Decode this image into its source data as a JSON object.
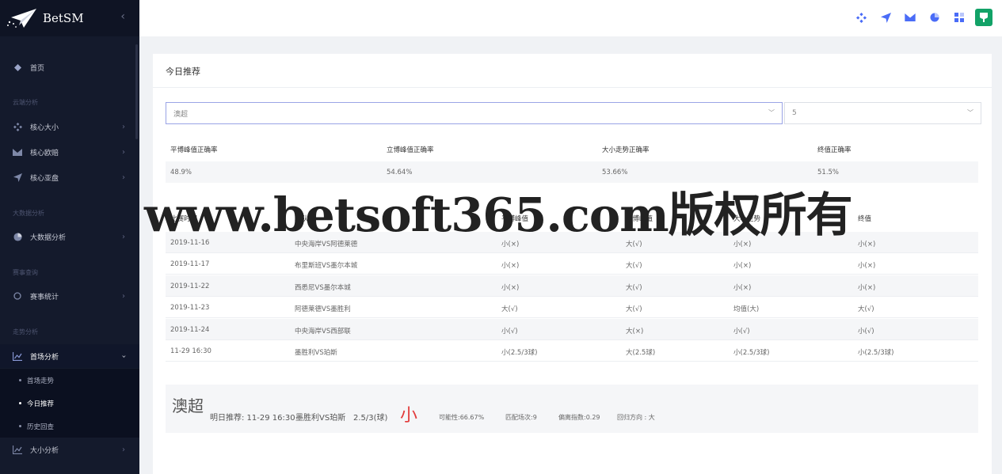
{
  "brand": {
    "name": "BetSM",
    "collapse_icon": "chevron-left-icon"
  },
  "sidebar": {
    "home": "首页",
    "groups": [
      "云端分析",
      "大数据分析",
      "赛事查询",
      "走势分析"
    ],
    "items": [
      {
        "label": "核心大小",
        "icon": "diamond-cluster-icon"
      },
      {
        "label": "核心欧赔",
        "icon": "mail-icon"
      },
      {
        "label": "核心亚盘",
        "icon": "send-icon"
      },
      {
        "label": "大数据分析",
        "icon": "pie-icon"
      },
      {
        "label": "赛事统计",
        "icon": "circle-icon"
      },
      {
        "label": "首场分析",
        "icon": "line-chart-icon"
      },
      {
        "label": "大小分析",
        "icon": "line-chart-icon"
      }
    ],
    "sub_items": [
      "首场走势",
      "今日推荐",
      "历史回查"
    ]
  },
  "card": {
    "title": "今日推荐"
  },
  "filters": {
    "league": "澳超",
    "count": "5"
  },
  "rates": {
    "headers": [
      "平博峰值正确率",
      "立博峰值正确率",
      "大小走势正确率",
      "终值正确率"
    ],
    "values": [
      "48.9%",
      "54.64%",
      "53.66%",
      "51.5%"
    ]
  },
  "table": {
    "headers": [
      "比赛时间",
      "球队",
      "平博峰值",
      "立博峰值",
      "大小走势",
      "终值"
    ],
    "rows": [
      [
        "2019-11-16",
        "中央海岸VS阿德莱德",
        "小(×)",
        "大(√)",
        "小(×)",
        "小(×)"
      ],
      [
        "2019-11-17",
        "布里斯班VS墨尔本城",
        "小(×)",
        "大(√)",
        "小(×)",
        "小(×)"
      ],
      [
        "2019-11-22",
        "西悉尼VS墨尔本城",
        "小(×)",
        "大(√)",
        "小(×)",
        "小(×)"
      ],
      [
        "2019-11-23",
        "阿德莱德VS墨胜利",
        "大(√)",
        "大(√)",
        "均值(大)",
        "大(√)"
      ],
      [
        "2019-11-24",
        "中央海岸VS西部联",
        "小(√)",
        "大(×)",
        "小(√)",
        "小(√)"
      ],
      [
        "11-29 16:30",
        "墨胜利VS珀斯",
        "小(2.5/3球)",
        "大(2.5球)",
        "小(2.5/3球)",
        "小(2.5/3球)"
      ]
    ]
  },
  "summary": {
    "league": "澳超",
    "tomorrow": "明日推荐: 11-29 16:30",
    "match": "墨胜利VS珀斯",
    "line": "2.5/3(球)",
    "prediction": "小",
    "probability": "可能性:66.67%",
    "matches": "匹配场次:9",
    "deviation": "偏离指数:0.29",
    "direction": "回归方向 : 大"
  },
  "watermark": "www.betsoft365.com版权所有",
  "colors": {
    "sidebar": "#141a2c",
    "accent": "#3b5bdb",
    "prediction": "#e23b3b",
    "avatar": "#12a267"
  }
}
